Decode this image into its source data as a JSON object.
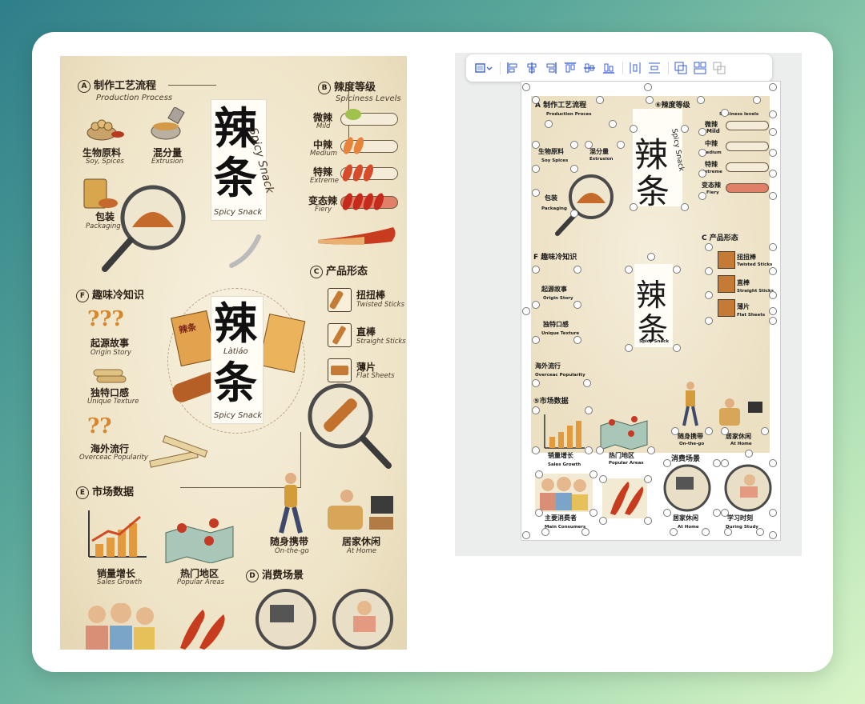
{
  "poster": {
    "section_a": {
      "letter": "A",
      "title": "制作工艺流程",
      "subtitle": "Production Process",
      "steps": [
        {
          "label": "生物原料",
          "sub": "Soy, Spices"
        },
        {
          "label": "混分量",
          "sub": "Extrusion"
        },
        {
          "label": "包装",
          "sub": "Packaging"
        }
      ]
    },
    "title_card": {
      "char1": "辣",
      "char2": "条",
      "script": "Spicy Snack",
      "sub": "Spicy Snack"
    },
    "section_b": {
      "letter": "B",
      "title": "辣度等级",
      "subtitle": "Spiciness Levels",
      "levels": [
        {
          "label": "微辣",
          "sub": "Mild",
          "level": 1
        },
        {
          "label": "中辣",
          "sub": "Medium",
          "level": 2
        },
        {
          "label": "特辣",
          "sub": "Extreme",
          "level": 3
        },
        {
          "label": "变态辣",
          "sub": "Fiery",
          "level": 4
        }
      ]
    },
    "section_c": {
      "letter": "C",
      "title": "产品形态",
      "forms": [
        {
          "label": "扭扭棒",
          "sub": "Twisted Sticks"
        },
        {
          "label": "直棒",
          "sub": "Straight Sticks"
        },
        {
          "label": "薄片",
          "sub": "Flat Sheets"
        }
      ]
    },
    "center": {
      "char1": "辣",
      "pinyin": "Làtiáo",
      "char2": "条",
      "sub": "Spicy Snack",
      "bag_text": "辣条"
    },
    "section_f": {
      "letter": "F",
      "title": "趣味冷知识",
      "facts": [
        {
          "label": "起源故事",
          "sub": "Origin Story"
        },
        {
          "label": "独特口感",
          "sub": "Unique Texture"
        },
        {
          "label": "海外流行",
          "sub": "Overceac Popularity"
        }
      ]
    },
    "section_e": {
      "letter": "E",
      "title": "市场数据",
      "items": [
        {
          "label": "销量增长",
          "sub": "Sales Growth"
        },
        {
          "label": "热门地区",
          "sub": "Popular Areas"
        }
      ]
    },
    "section_d": {
      "letter": "D",
      "title": "消费场景",
      "items": [
        {
          "label": "随身携带",
          "sub": "On-the-go"
        },
        {
          "label": "居家休闲",
          "sub": "At Home"
        }
      ]
    }
  },
  "toolbar": {
    "buttons": [
      "frame-icon",
      "align-left-icon",
      "align-center-h-icon",
      "align-right-icon",
      "align-top-icon",
      "align-middle-icon",
      "align-bottom-icon",
      "distribute-h-icon",
      "distribute-v-icon",
      "group-icon",
      "ungroup-icon",
      "layer-icon"
    ]
  },
  "editor": {
    "a_title": "A  制作工艺流程",
    "a_sub": "Production Proces",
    "a1": "生物原料",
    "a1s": "Soy Spices",
    "a2": "混分量",
    "a2s": "Extrusion",
    "a3": "包装",
    "a3s": "Packaging",
    "b_title": "⑥辣度等级",
    "b_sub": "Spiciness levels",
    "b1": "微辣",
    "b1s": "Mild",
    "b2": "中辣",
    "b2s": "Medium",
    "b3": "特辣",
    "b3s": "Extreme",
    "b4": "变态辣",
    "b4s": "Fiery",
    "title_c1": "辣",
    "title_c2": "条",
    "script": "Spicy Snack",
    "c_title": "C  产品形态",
    "c1": "扭扭棒",
    "c1s": "Twisted Sticks",
    "c2": "直棒",
    "c2s": "Straight Sticks",
    "c3": "薄片",
    "c3s": "Flat Sheets",
    "f_title": "F  趣味冷知识",
    "f1": "起源故事",
    "f1s": "Origin Story",
    "f2": "独特口感",
    "f2s": "Unique Texture",
    "f3": "海外流行",
    "f3s": "Overceac Popularity",
    "center_c1": "辣",
    "center_c2": "条",
    "center_sub": "Spicy Snack",
    "e_title": "⑤市场数据",
    "e1": "销量增长",
    "e1s": "Sales Growth",
    "e2": "热门地区",
    "e2s": "Popular Areas",
    "d_title": "消费场景",
    "d1": "随身携带",
    "d1s": "On-the-go",
    "d2": "居家休闲",
    "d2s": "At Home",
    "g1": "主要消费者",
    "g1s": "Main Consumers",
    "g3": "居家休闲",
    "g3s": "At Home",
    "g4": "学习时刻",
    "g4s": "During Study"
  }
}
